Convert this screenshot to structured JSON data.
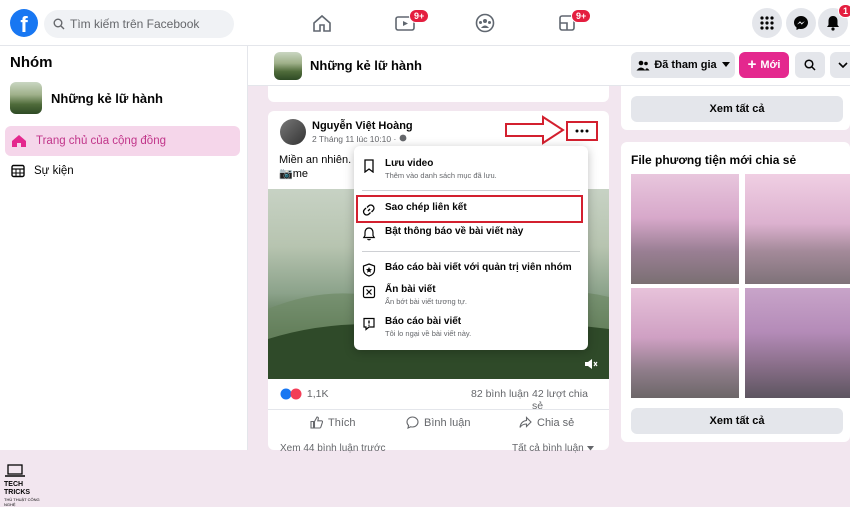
{
  "topbar": {
    "logo": "f",
    "search_placeholder": "Tìm kiếm trên Facebook",
    "nav": [
      {
        "icon": "home-icon",
        "badge": ""
      },
      {
        "icon": "watch-icon",
        "badge": "9+"
      },
      {
        "icon": "groups-icon",
        "badge": ""
      },
      {
        "icon": "gaming-icon",
        "badge": "9+"
      }
    ],
    "right": [
      {
        "icon": "menu-grid-icon",
        "badge": ""
      },
      {
        "icon": "messenger-icon",
        "badge": ""
      },
      {
        "icon": "bell-icon",
        "badge": "1"
      }
    ]
  },
  "sidebar": {
    "title": "Nhóm",
    "group_name": "Những kẻ lữ hành",
    "items": [
      {
        "label": "Trang chủ của cộng đồng",
        "icon": "home-icon",
        "active": true
      },
      {
        "label": "Sự kiện",
        "icon": "calendar-icon",
        "active": false
      }
    ],
    "brand": {
      "line1": "TECH TRICKS",
      "line2": "THỦ THUẬT CÔNG NGHỆ"
    }
  },
  "group_header": {
    "name": "Những kẻ lữ hành",
    "joined_label": "Đã tham gia",
    "new_label": "Mới"
  },
  "post": {
    "author": "Nguyễn Việt Hoàng",
    "date": "2 Tháng 11 lúc 10:10 ·",
    "text_line1": "Miền an nhiên.",
    "text_line2": "📷me",
    "reaction_count": "1,1K",
    "comments": "82 bình luận",
    "shares": "42 lượt chia sẻ",
    "like_label": "Thích",
    "comment_label": "Bình luận",
    "share_label": "Chia sẻ",
    "more_comments": "Xem 44 bình luận trước",
    "all_comments": "Tất cả bình luận"
  },
  "menu": {
    "items": [
      {
        "label": "Lưu video",
        "sub": "Thêm vào danh sách mục đã lưu.",
        "icon": "bookmark-icon"
      },
      {
        "label": "Sao chép liên kết",
        "sub": "",
        "icon": "link-icon"
      },
      {
        "label": "Bật thông báo về bài viết này",
        "sub": "",
        "icon": "bell-icon"
      },
      {
        "label": "Báo cáo bài viết với quản trị viên nhóm",
        "sub": "",
        "icon": "shield-star-icon"
      },
      {
        "label": "Ẩn bài viết",
        "sub": "Ẩn bớt bài viết tương tự.",
        "icon": "hide-x-icon"
      },
      {
        "label": "Báo cáo bài viết",
        "sub": "Tôi lo ngại về bài viết này.",
        "icon": "report-icon"
      }
    ]
  },
  "right": {
    "see_all_1": "Xem tất cả",
    "media_title": "File phương tiện mới chia sẻ",
    "see_all_2": "Xem tất cả"
  },
  "colors": {
    "accent": "#e4288e",
    "fb_blue": "#1877f2",
    "highlight_red": "#d3202f"
  }
}
